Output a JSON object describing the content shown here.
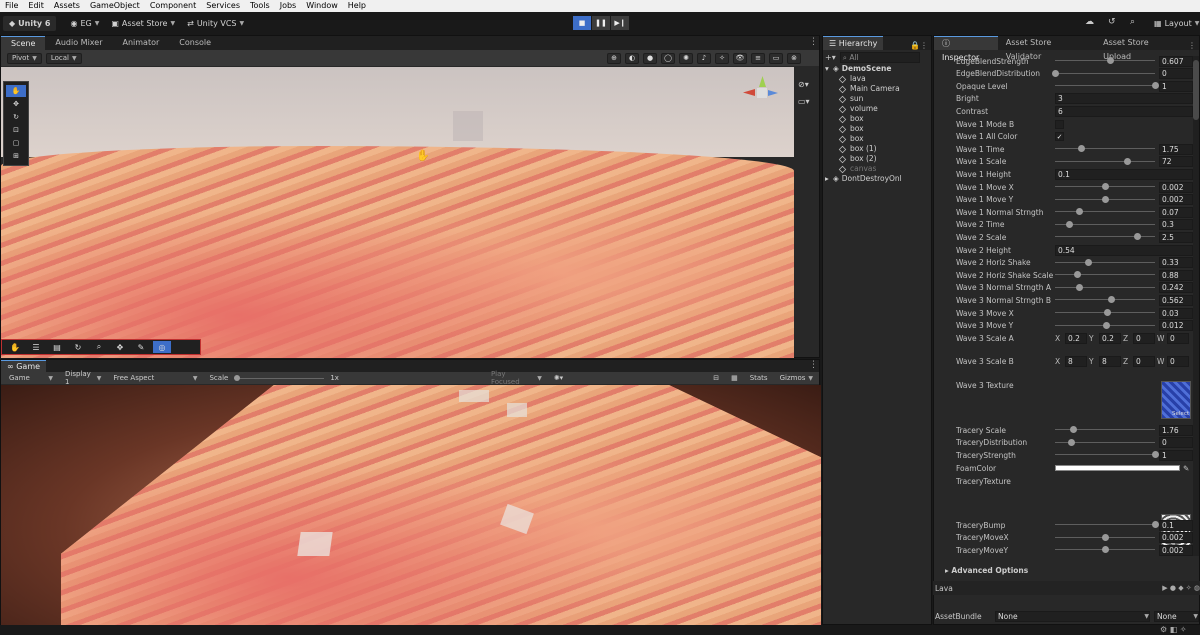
{
  "menubar": [
    "File",
    "Edit",
    "Assets",
    "GameObject",
    "Component",
    "Services",
    "Tools",
    "Jobs",
    "Window",
    "Help"
  ],
  "toolbar": {
    "unity": "Unity 6",
    "account": "EG",
    "asset_store": "Asset Store",
    "vcs": "Unity VCS",
    "layout": "Layout"
  },
  "scene_tabs": [
    "Scene",
    "Audio Mixer",
    "Animator",
    "Console"
  ],
  "scene_bar": {
    "pivot": "Pivot",
    "local": "Local"
  },
  "game": {
    "tab": "Game",
    "mode": "Game",
    "display": "Display 1",
    "aspect": "Free Aspect",
    "scale_label": "Scale",
    "scale_value": "1x",
    "play_focused": "Play Focused",
    "stats": "Stats",
    "gizmos": "Gizmos"
  },
  "hierarchy": {
    "tab": "Hierarchy",
    "search": "All",
    "scene": "DemoScene",
    "items": [
      "lava",
      "Main Camera",
      "sun",
      "volume",
      "box",
      "box",
      "box",
      "box (1)",
      "box (2)",
      "canvas"
    ],
    "dont_destroy": "DontDestroyOnl"
  },
  "inspector_tabs": [
    "Inspector",
    "Asset Store Validator",
    "Asset Store Upload"
  ],
  "inspector": {
    "rows": [
      {
        "label": "EdgeBlendStrength",
        "type": "slider",
        "pos": 0.55,
        "value": "0.607"
      },
      {
        "label": "EdgeBlendDistribution",
        "type": "slider",
        "pos": 0.0,
        "value": "0"
      },
      {
        "label": "Opaque Level",
        "type": "slider",
        "pos": 1.0,
        "value": "1"
      },
      {
        "label": "Bright",
        "type": "field",
        "value": "3"
      },
      {
        "label": "Contrast",
        "type": "field",
        "value": "6"
      },
      {
        "label": "Wave 1 Mode B",
        "type": "check",
        "value": ""
      },
      {
        "label": "Wave 1 All Color",
        "type": "check",
        "value": "✓"
      },
      {
        "label": "Wave 1 Time",
        "type": "slider",
        "pos": 0.26,
        "value": "1.75"
      },
      {
        "label": "Wave 1 Scale",
        "type": "slider",
        "pos": 0.72,
        "value": "72"
      },
      {
        "label": "Wave 1 Height",
        "type": "field",
        "value": "0.1"
      },
      {
        "label": "Wave 1 Move X",
        "type": "slider",
        "pos": 0.5,
        "value": "0.002"
      },
      {
        "label": "Wave 1 Move Y",
        "type": "slider",
        "pos": 0.5,
        "value": "0.002"
      },
      {
        "label": "Wave 1 Normal Strngth",
        "type": "slider",
        "pos": 0.24,
        "value": "0.07"
      },
      {
        "label": "Wave 2 Time",
        "type": "slider",
        "pos": 0.14,
        "value": "0.3"
      },
      {
        "label": "Wave 2 Scale",
        "type": "slider",
        "pos": 0.82,
        "value": "2.5"
      },
      {
        "label": "Wave 2 Height",
        "type": "field",
        "value": "0.54"
      },
      {
        "label": "Wave 2 Horiz Shake",
        "type": "slider",
        "pos": 0.33,
        "value": "0.33"
      },
      {
        "label": "Wave 2 Horiz Shake Scale",
        "type": "slider",
        "pos": 0.22,
        "value": "0.88"
      },
      {
        "label": "Wave 3 Normal Strngth A",
        "type": "slider",
        "pos": 0.24,
        "value": "0.242"
      },
      {
        "label": "Wave 3 Normal Strngth B",
        "type": "slider",
        "pos": 0.56,
        "value": "0.562"
      },
      {
        "label": "Wave 3 Move X",
        "type": "slider",
        "pos": 0.52,
        "value": "0.03"
      },
      {
        "label": "Wave 3 Move Y",
        "type": "slider",
        "pos": 0.51,
        "value": "0.012"
      }
    ],
    "wave3_scale_a": {
      "label": "Wave 3 Scale A",
      "x": "0.2",
      "y": "0.2",
      "z": "0",
      "w": "0"
    },
    "wave3_scale_b": {
      "label": "Wave 3 Scale B",
      "x": "8",
      "y": "8",
      "z": "0",
      "w": "0"
    },
    "wave3_texture": "Wave 3 Texture",
    "select": "Select",
    "rows2": [
      {
        "label": "Tracery Scale",
        "type": "slider",
        "pos": 0.18,
        "value": "1.76"
      },
      {
        "label": "TraceryDistribution",
        "type": "slider",
        "pos": 0.16,
        "value": "0"
      },
      {
        "label": "TraceryStrength",
        "type": "slider",
        "pos": 1.0,
        "value": "1"
      }
    ],
    "foam_color": "FoamColor",
    "tracery_texture": "TraceryTexture",
    "rows3": [
      {
        "label": "TraceryBump",
        "type": "slider",
        "pos": 1.0,
        "value": "0.1"
      },
      {
        "label": "TraceryMoveX",
        "type": "slider",
        "pos": 0.5,
        "value": "0.002"
      },
      {
        "label": "TraceryMoveY",
        "type": "slider",
        "pos": 0.5,
        "value": "0.002"
      }
    ],
    "advanced": "Advanced Options",
    "material_name": "Lava",
    "asset_bundle": "AssetBundle",
    "bundle_value": "None",
    "variant_value": "None"
  },
  "colors": {
    "accent": "#3d6ec8",
    "lava": "#e98b72"
  }
}
